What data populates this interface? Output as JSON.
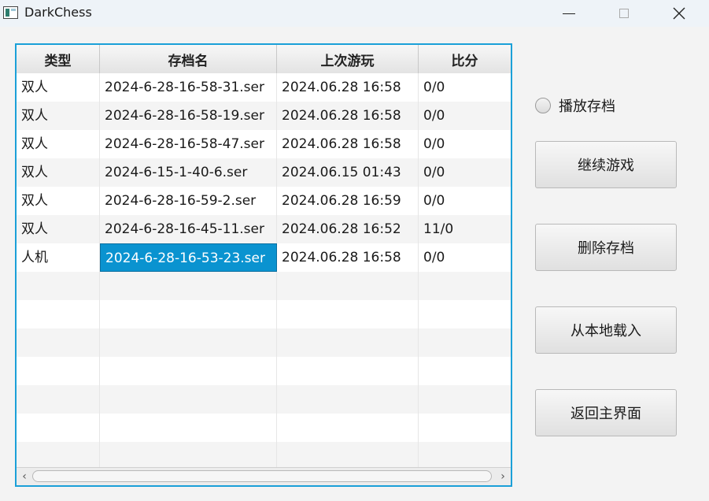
{
  "window": {
    "title": "DarkChess"
  },
  "table": {
    "columns": [
      "类型",
      "存档名",
      "上次游玩",
      "比分"
    ],
    "rows": [
      {
        "type": "双人",
        "name": "2024-6-28-16-58-31.ser",
        "last_played": "2024.06.28 16:58",
        "score": "0/0"
      },
      {
        "type": "双人",
        "name": "2024-6-28-16-58-19.ser",
        "last_played": "2024.06.28 16:58",
        "score": "0/0"
      },
      {
        "type": "双人",
        "name": "2024-6-28-16-58-47.ser",
        "last_played": "2024.06.28 16:58",
        "score": "0/0"
      },
      {
        "type": "双人",
        "name": "2024-6-15-1-40-6.ser",
        "last_played": "2024.06.15 01:43",
        "score": "0/0"
      },
      {
        "type": "双人",
        "name": "2024-6-28-16-59-2.ser",
        "last_played": "2024.06.28 16:59",
        "score": "0/0"
      },
      {
        "type": "双人",
        "name": "2024-6-28-16-45-11.ser",
        "last_played": "2024.06.28 16:52",
        "score": "11/0"
      },
      {
        "type": "人机",
        "name": "2024-6-28-16-53-23.ser",
        "last_played": "2024.06.28 16:58",
        "score": "0/0"
      }
    ],
    "selected_row": 6,
    "selected_column": "name"
  },
  "controls": {
    "replay_radio_label": "播放存档",
    "continue_label": "继续游戏",
    "delete_label": "删除存档",
    "load_local_label": "从本地载入",
    "back_label": "返回主界面"
  },
  "colors": {
    "selection": "#0a93d0",
    "focus_border": "#1ba0d8"
  },
  "icons": {
    "app": "app-icon",
    "minimize": "minimize-icon",
    "maximize": "maximize-icon",
    "close": "close-icon",
    "scroll_left": "chevron-left-icon",
    "scroll_right": "chevron-right-icon"
  }
}
